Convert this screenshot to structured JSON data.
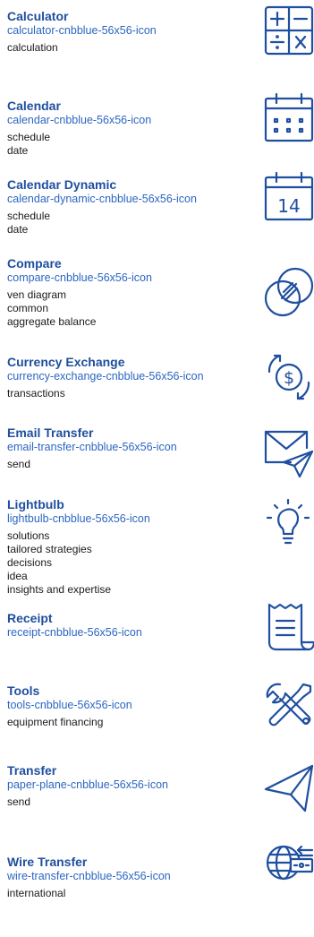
{
  "icons": [
    {
      "title": "Calculator",
      "name": "calculator-cnbblue-56x56-icon",
      "tags": [
        "calculation"
      ]
    },
    {
      "title": "Calendar",
      "name": "calendar-cnbblue-56x56-icon",
      "tags": [
        "schedule",
        "date"
      ]
    },
    {
      "title": "Calendar Dynamic",
      "name": "calendar-dynamic-cnbblue-56x56-icon",
      "tags": [
        "schedule",
        "date"
      ],
      "glyph_text": "14"
    },
    {
      "title": "Compare",
      "name": "compare-cnbblue-56x56-icon",
      "tags": [
        "ven diagram",
        "common",
        "aggregate balance"
      ]
    },
    {
      "title": "Currency Exchange",
      "name": "currency-exchange-cnbblue-56x56-icon",
      "tags": [
        "transactions"
      ]
    },
    {
      "title": "Email Transfer",
      "name": "email-transfer-cnbblue-56x56-icon",
      "tags": [
        "send"
      ]
    },
    {
      "title": "Lightbulb",
      "name": "lightbulb-cnbblue-56x56-icon",
      "tags": [
        "solutions",
        "tailored strategies",
        "decisions",
        "idea",
        "insights and expertise"
      ]
    },
    {
      "title": "Receipt",
      "name": "receipt-cnbblue-56x56-icon",
      "tags": []
    },
    {
      "title": "Tools",
      "name": "tools-cnbblue-56x56-icon",
      "tags": [
        "equipment financing"
      ]
    },
    {
      "title": "Transfer",
      "name": "paper-plane-cnbblue-56x56-icon",
      "tags": [
        "send"
      ]
    },
    {
      "title": "Wire Transfer",
      "name": "wire-transfer-cnbblue-56x56-icon",
      "tags": [
        "international"
      ]
    }
  ],
  "colors": {
    "title": "#1f4fa0",
    "icon_name": "#2c66c2",
    "tag": "#1a1a1a",
    "glyph": "#1f4fa0"
  }
}
